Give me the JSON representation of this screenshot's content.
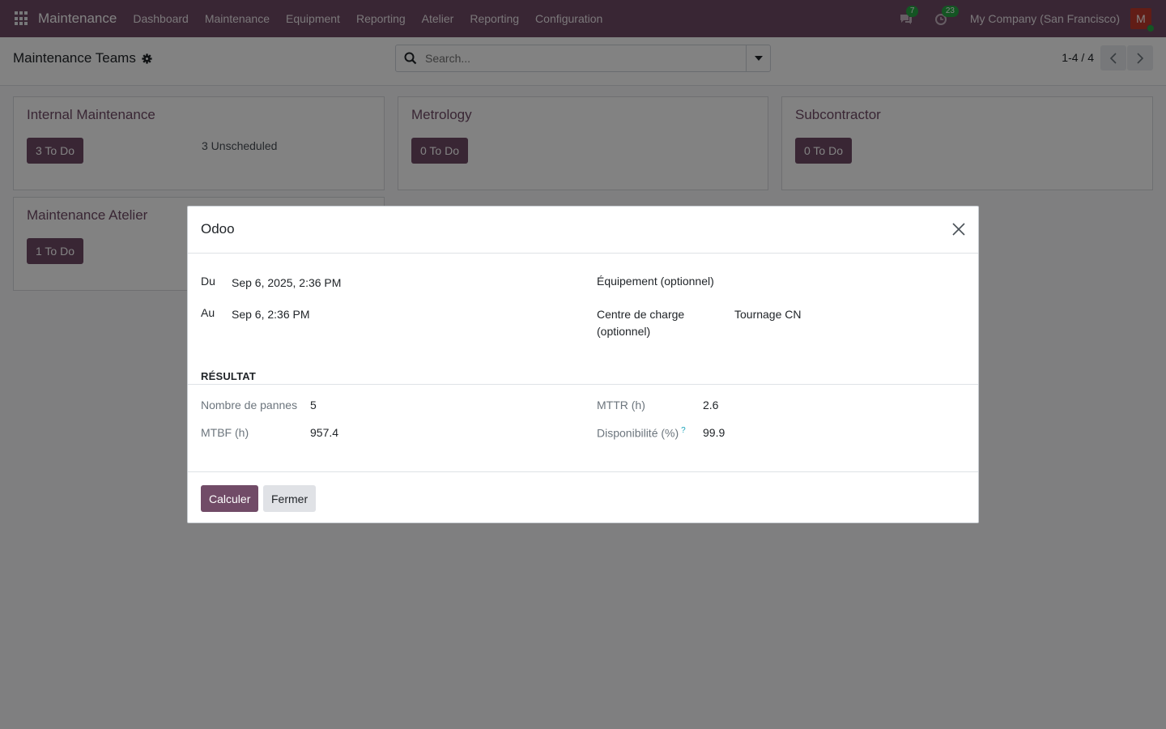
{
  "navbar": {
    "app_name": "Maintenance",
    "menu": [
      "Dashboard",
      "Maintenance",
      "Equipment",
      "Reporting",
      "Atelier",
      "Reporting",
      "Configuration"
    ],
    "messages_count": "7",
    "activities_count": "23",
    "company": "My Company (San Francisco)",
    "avatar_letter": "M"
  },
  "control": {
    "title": "Maintenance Teams",
    "search_placeholder": "Search...",
    "pager": "1-4 / 4"
  },
  "teams": [
    {
      "name": "Internal Maintenance",
      "todo": "3 To Do",
      "unscheduled": "3 Unscheduled"
    },
    {
      "name": "Metrology",
      "todo": "0 To Do",
      "unscheduled": ""
    },
    {
      "name": "Subcontractor",
      "todo": "0 To Do",
      "unscheduled": ""
    },
    {
      "name": "Maintenance Atelier",
      "todo": "1 To Do",
      "unscheduled": ""
    }
  ],
  "modal": {
    "title": "Odoo",
    "from_label": "Du",
    "from_value": "Sep 6, 2025, 2:36 PM",
    "to_label": "Au",
    "to_value": "Sep 6, 2:36 PM",
    "equipment_label": "Équipement (optionnel)",
    "workcenter_label_line1": "Centre de charge",
    "workcenter_label_line2": "(optionnel)",
    "workcenter_value": "Tournage CN",
    "section": "RÉSULTAT",
    "failures_label": "Nombre de pannes",
    "failures_value": "5",
    "mtbf_label": "MTBF (h)",
    "mtbf_value": "957.4",
    "mttr_label": "MTTR (h)",
    "mttr_value": "2.6",
    "availability_label": "Disponibilité (%)",
    "availability_help": "?",
    "availability_value": "99.9",
    "compute_button": "Calculer",
    "close_button": "Fermer"
  },
  "colors": {
    "brand": "#714B67",
    "success": "#28a745",
    "avatar": "#c0392b"
  }
}
